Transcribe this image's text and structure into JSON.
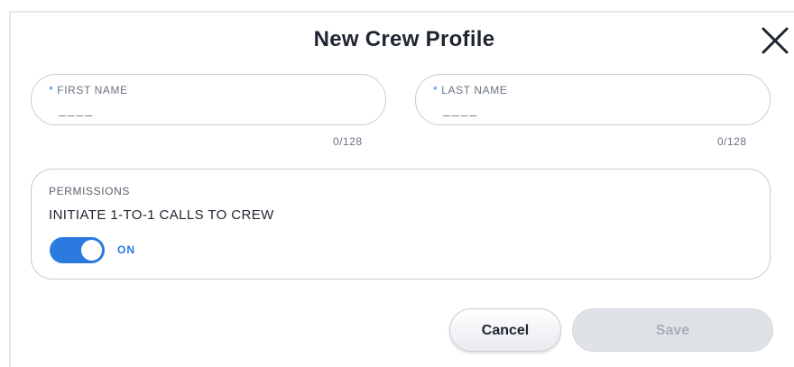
{
  "dialog": {
    "title": "New Crew Profile",
    "close_icon": "close-icon"
  },
  "fields": {
    "first_name": {
      "required_marker": "*",
      "label": "FIRST NAME",
      "placeholder": "____",
      "value": "",
      "counter": "0/128"
    },
    "last_name": {
      "required_marker": "*",
      "label": "LAST NAME",
      "placeholder": "____",
      "value": "",
      "counter": "0/128"
    }
  },
  "permissions": {
    "heading": "PERMISSIONS",
    "items": [
      {
        "label": "INITIATE 1-TO-1 CALLS TO CREW",
        "enabled": true,
        "state_label": "ON"
      }
    ]
  },
  "actions": {
    "cancel_label": "Cancel",
    "save_label": "Save",
    "save_enabled": false
  },
  "colors": {
    "accent": "#2b7ae0",
    "title_text": "#1f2530",
    "border": "#c8ccd3",
    "disabled_button": "#dfe2e7"
  }
}
